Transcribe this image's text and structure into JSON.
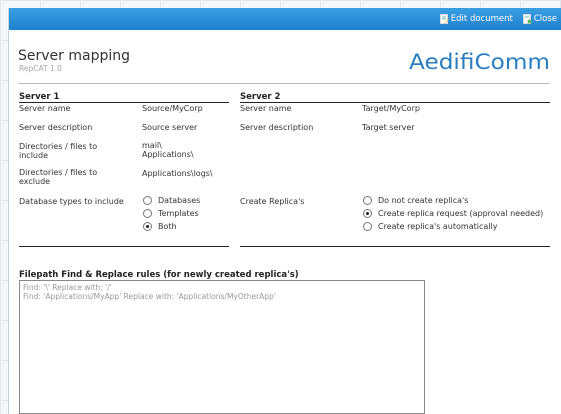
{
  "toolbar": {
    "edit_label": "Edit document",
    "close_label": "Close"
  },
  "header": {
    "title": "Server mapping",
    "subtitle": "RepCAT 1.0",
    "logo": "AedifiComm"
  },
  "server1": {
    "heading": "Server 1",
    "name_label": "Server name",
    "name_value": "Source/MyCorp",
    "desc_label": "Server description",
    "desc_value": "Source server",
    "include_label": "Directories / files to include",
    "include_values": [
      "mail\\",
      "Applications\\"
    ],
    "exclude_label": "Directories / files to exclude",
    "exclude_value": "Applications\\logs\\",
    "dbtypes_label": "Database types to include",
    "dbtypes_options": [
      "Databases",
      "Templates",
      "Both"
    ],
    "dbtypes_selected": "Both"
  },
  "server2": {
    "heading": "Server 2",
    "name_label": "Server name",
    "name_value": "Target/MyCorp",
    "desc_label": "Server description",
    "desc_value": "Target server",
    "replica_label": "Create Replica's",
    "replica_options": [
      "Do not create replica's",
      "Create replica request (approval needed)",
      "Create replica's automatically"
    ],
    "replica_selected": "Create replica request (approval needed)"
  },
  "rules": {
    "heading": "Filepath Find & Replace rules (for newly created replica's)",
    "lines": [
      "Find: '\\' Replace with: '/'",
      "Find: 'Applications/MyApp' Replace with: 'Applications/MyOtherApp'"
    ]
  },
  "colors": {
    "toolbar": "#2a8fd8",
    "logo": "#2b7ec1"
  }
}
